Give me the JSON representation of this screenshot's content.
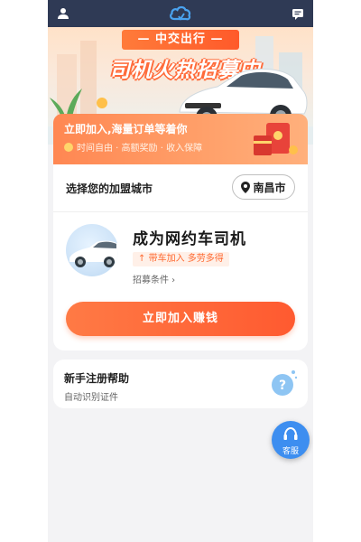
{
  "topbar": {
    "user_icon": "user-icon",
    "logo_icon": "cloud-logo-icon",
    "message_icon": "message-icon"
  },
  "hero": {
    "pill_text": "— 中交出行 —",
    "headline": "司机火热招募中"
  },
  "banner": {
    "title": "立即加入,海量订单等着你",
    "subtitle": "时间自由 · 高额奖励 · 收入保障"
  },
  "city": {
    "label": "选择您的加盟城市",
    "selected": "南昌市"
  },
  "driver_card": {
    "title": "成为网约车司机",
    "tag": "带车加入 多劳多得",
    "conditions_link": "招募条件 ›"
  },
  "join_button": "立即加入赚钱",
  "help_card": {
    "title": "新手注册帮助",
    "subtitle": "自动识别证件"
  },
  "service_button": "客服",
  "colors": {
    "accent": "#ff6a32",
    "topbar": "#2f3a55",
    "service": "#3d8ef0"
  }
}
